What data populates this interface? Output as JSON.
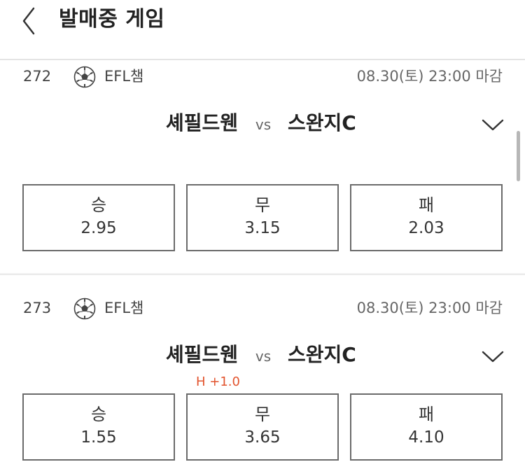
{
  "header": {
    "title": "발매중 게임",
    "back_icon": "chevron-left-icon"
  },
  "colors": {
    "handicap": "#e2532d",
    "border": "#6b6b6b",
    "divider": "#e4e4e4"
  },
  "games": [
    {
      "number": "272",
      "sport_icon": "soccer-ball-icon",
      "league": "EFL챔",
      "deadline": "08.30(토) 23:00 마감",
      "home_team": "셰필드웬",
      "vs": "vs",
      "away_team": "스완지C",
      "handicap": "",
      "odds": [
        {
          "label": "승",
          "value": "2.95"
        },
        {
          "label": "무",
          "value": "3.15"
        },
        {
          "label": "패",
          "value": "2.03"
        }
      ]
    },
    {
      "number": "273",
      "sport_icon": "soccer-ball-icon",
      "league": "EFL챔",
      "deadline": "08.30(토) 23:00 마감",
      "home_team": "셰필드웬",
      "vs": "vs",
      "away_team": "스완지C",
      "handicap": "H +1.0",
      "odds": [
        {
          "label": "승",
          "value": "1.55"
        },
        {
          "label": "무",
          "value": "3.65"
        },
        {
          "label": "패",
          "value": "4.10"
        }
      ]
    }
  ]
}
